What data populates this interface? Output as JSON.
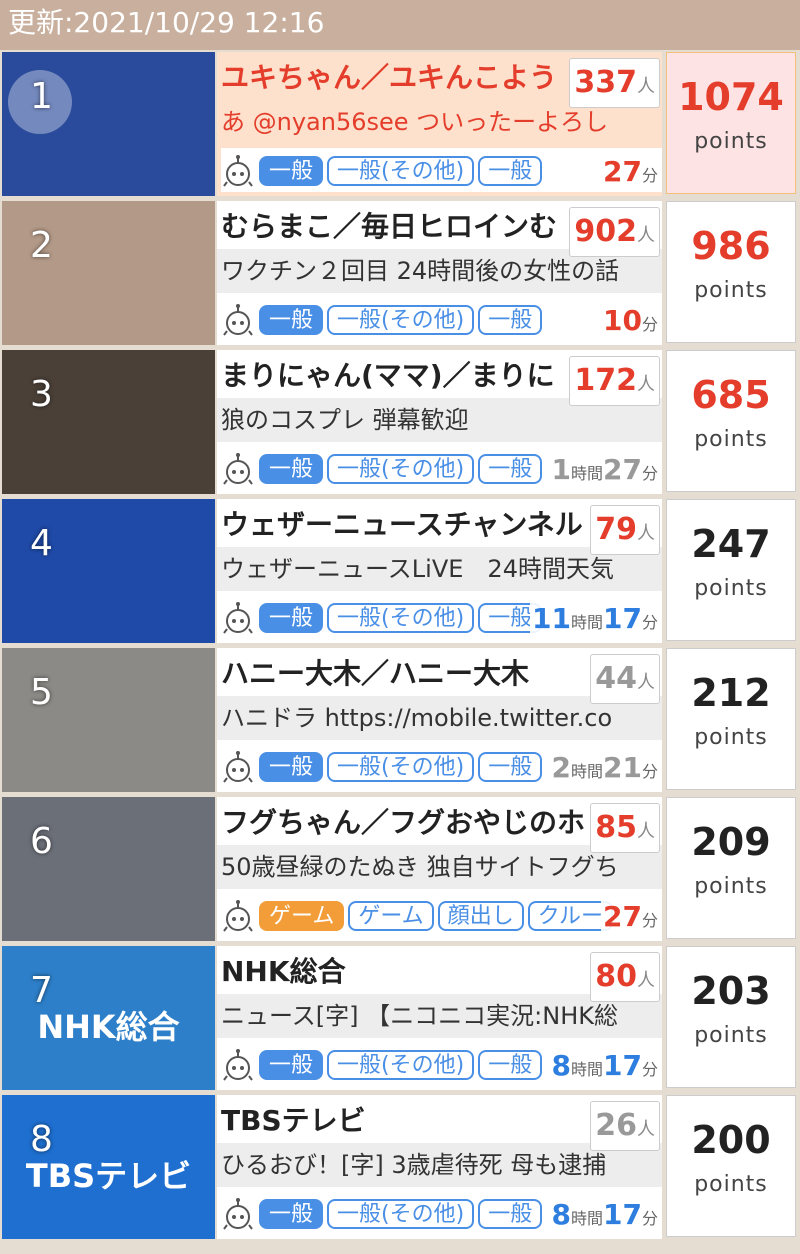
{
  "header": {
    "updated": "更新:2021/10/29 12:16"
  },
  "labels": {
    "viewer_unit": "人",
    "points_unit": "points",
    "min_unit": "分",
    "hour_unit": "時間"
  },
  "rows": [
    {
      "rank": "1",
      "title": "ユキちゃん／ユキんこよう",
      "desc": "あ @nyan56see ついったーよろし",
      "viewers": "337",
      "viewers_color": "red",
      "tags": [
        "一般",
        "一般(その他)",
        "一般"
      ],
      "tag_style": "normal",
      "time_h": "",
      "time_m": "27",
      "time_color": "red",
      "points": "1074",
      "points_color": "red",
      "thumb": "#2a4b9c"
    },
    {
      "rank": "2",
      "title": "むらまこ／毎日ヒロインむ",
      "desc": "ワクチン２回目 24時間後の女性の話",
      "viewers": "902",
      "viewers_color": "red",
      "tags": [
        "一般",
        "一般(その他)",
        "一般"
      ],
      "tag_style": "normal",
      "time_h": "",
      "time_m": "10",
      "time_color": "red",
      "points": "986",
      "points_color": "red",
      "thumb": "#b39a88"
    },
    {
      "rank": "3",
      "title": "まりにゃん(ママ)／まりに",
      "desc": "狼のコスプレ 弾幕歓迎",
      "viewers": "172",
      "viewers_color": "red",
      "tags": [
        "一般",
        "一般(その他)",
        "一般"
      ],
      "tag_style": "normal",
      "time_h": "1",
      "time_m": "27",
      "time_color": "grey",
      "points": "685",
      "points_color": "red",
      "thumb": "#4a4038"
    },
    {
      "rank": "4",
      "title": "ウェザーニュースチャンネル",
      "desc": "ウェザーニュースLiVE　24時間天気",
      "viewers": "79",
      "viewers_color": "red",
      "tags": [
        "一般",
        "一般(その他)",
        "一般"
      ],
      "tag_style": "normal",
      "time_h": "11",
      "time_m": "17",
      "time_color": "blue",
      "points": "247",
      "points_color": "black",
      "thumb": "#1f4aa8"
    },
    {
      "rank": "5",
      "title": "ハニー大木／ハニー大木",
      "desc": "ハニドラ https://mobile.twitter.co",
      "viewers": "44",
      "viewers_color": "grey",
      "tags": [
        "一般",
        "一般(その他)",
        "一般"
      ],
      "tag_style": "normal",
      "time_h": "2",
      "time_m": "21",
      "time_color": "grey",
      "points": "212",
      "points_color": "black",
      "thumb": "#8c8a86"
    },
    {
      "rank": "6",
      "title": "フグちゃん／フグおやじのホ",
      "desc": "50歳昼緑のたぬき 独自サイトフグち",
      "viewers": "85",
      "viewers_color": "red",
      "tags": [
        "ゲーム",
        "ゲーム",
        "顔出し",
        "クルー"
      ],
      "tag_style": "game",
      "time_h": "",
      "time_m": "27",
      "time_color": "red",
      "points": "209",
      "points_color": "black",
      "thumb": "#6b6f78"
    },
    {
      "rank": "7",
      "title": "NHK総合",
      "desc": "ニュース[字] 【ニコニコ実況:NHK総",
      "viewers": "80",
      "viewers_color": "red",
      "tags": [
        "一般",
        "一般(その他)",
        "一般"
      ],
      "tag_style": "normal",
      "time_h": "8",
      "time_m": "17",
      "time_color": "blue",
      "points": "203",
      "points_color": "black",
      "thumb": "#2d7fc9",
      "logo": "NHK総合"
    },
    {
      "rank": "8",
      "title": "TBSテレビ",
      "desc": "ひるおび！[字] 3歳虐待死 母も逮捕",
      "viewers": "26",
      "viewers_color": "grey",
      "tags": [
        "一般",
        "一般(その他)",
        "一般"
      ],
      "tag_style": "normal",
      "time_h": "8",
      "time_m": "17",
      "time_color": "blue",
      "points": "200",
      "points_color": "black",
      "thumb": "#1e6fd0",
      "logo": "TBSテレビ"
    }
  ]
}
